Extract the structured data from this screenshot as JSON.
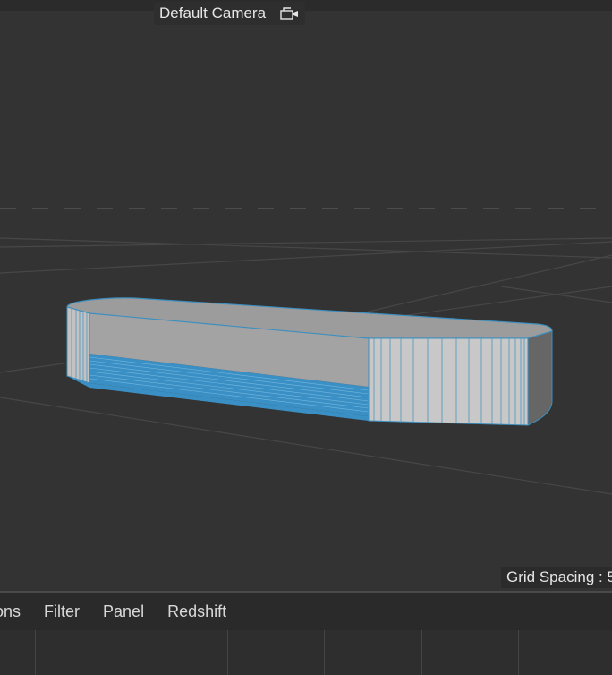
{
  "viewport": {
    "camera_label": "Default Camera",
    "camera_icon": "camera-icon",
    "grid_spacing_text": "Grid Spacing : 5",
    "object_color": "#3d8fbf",
    "background_color": "#333333"
  },
  "menu": {
    "items": [
      "ons",
      "Filter",
      "Panel",
      "Redshift"
    ]
  }
}
